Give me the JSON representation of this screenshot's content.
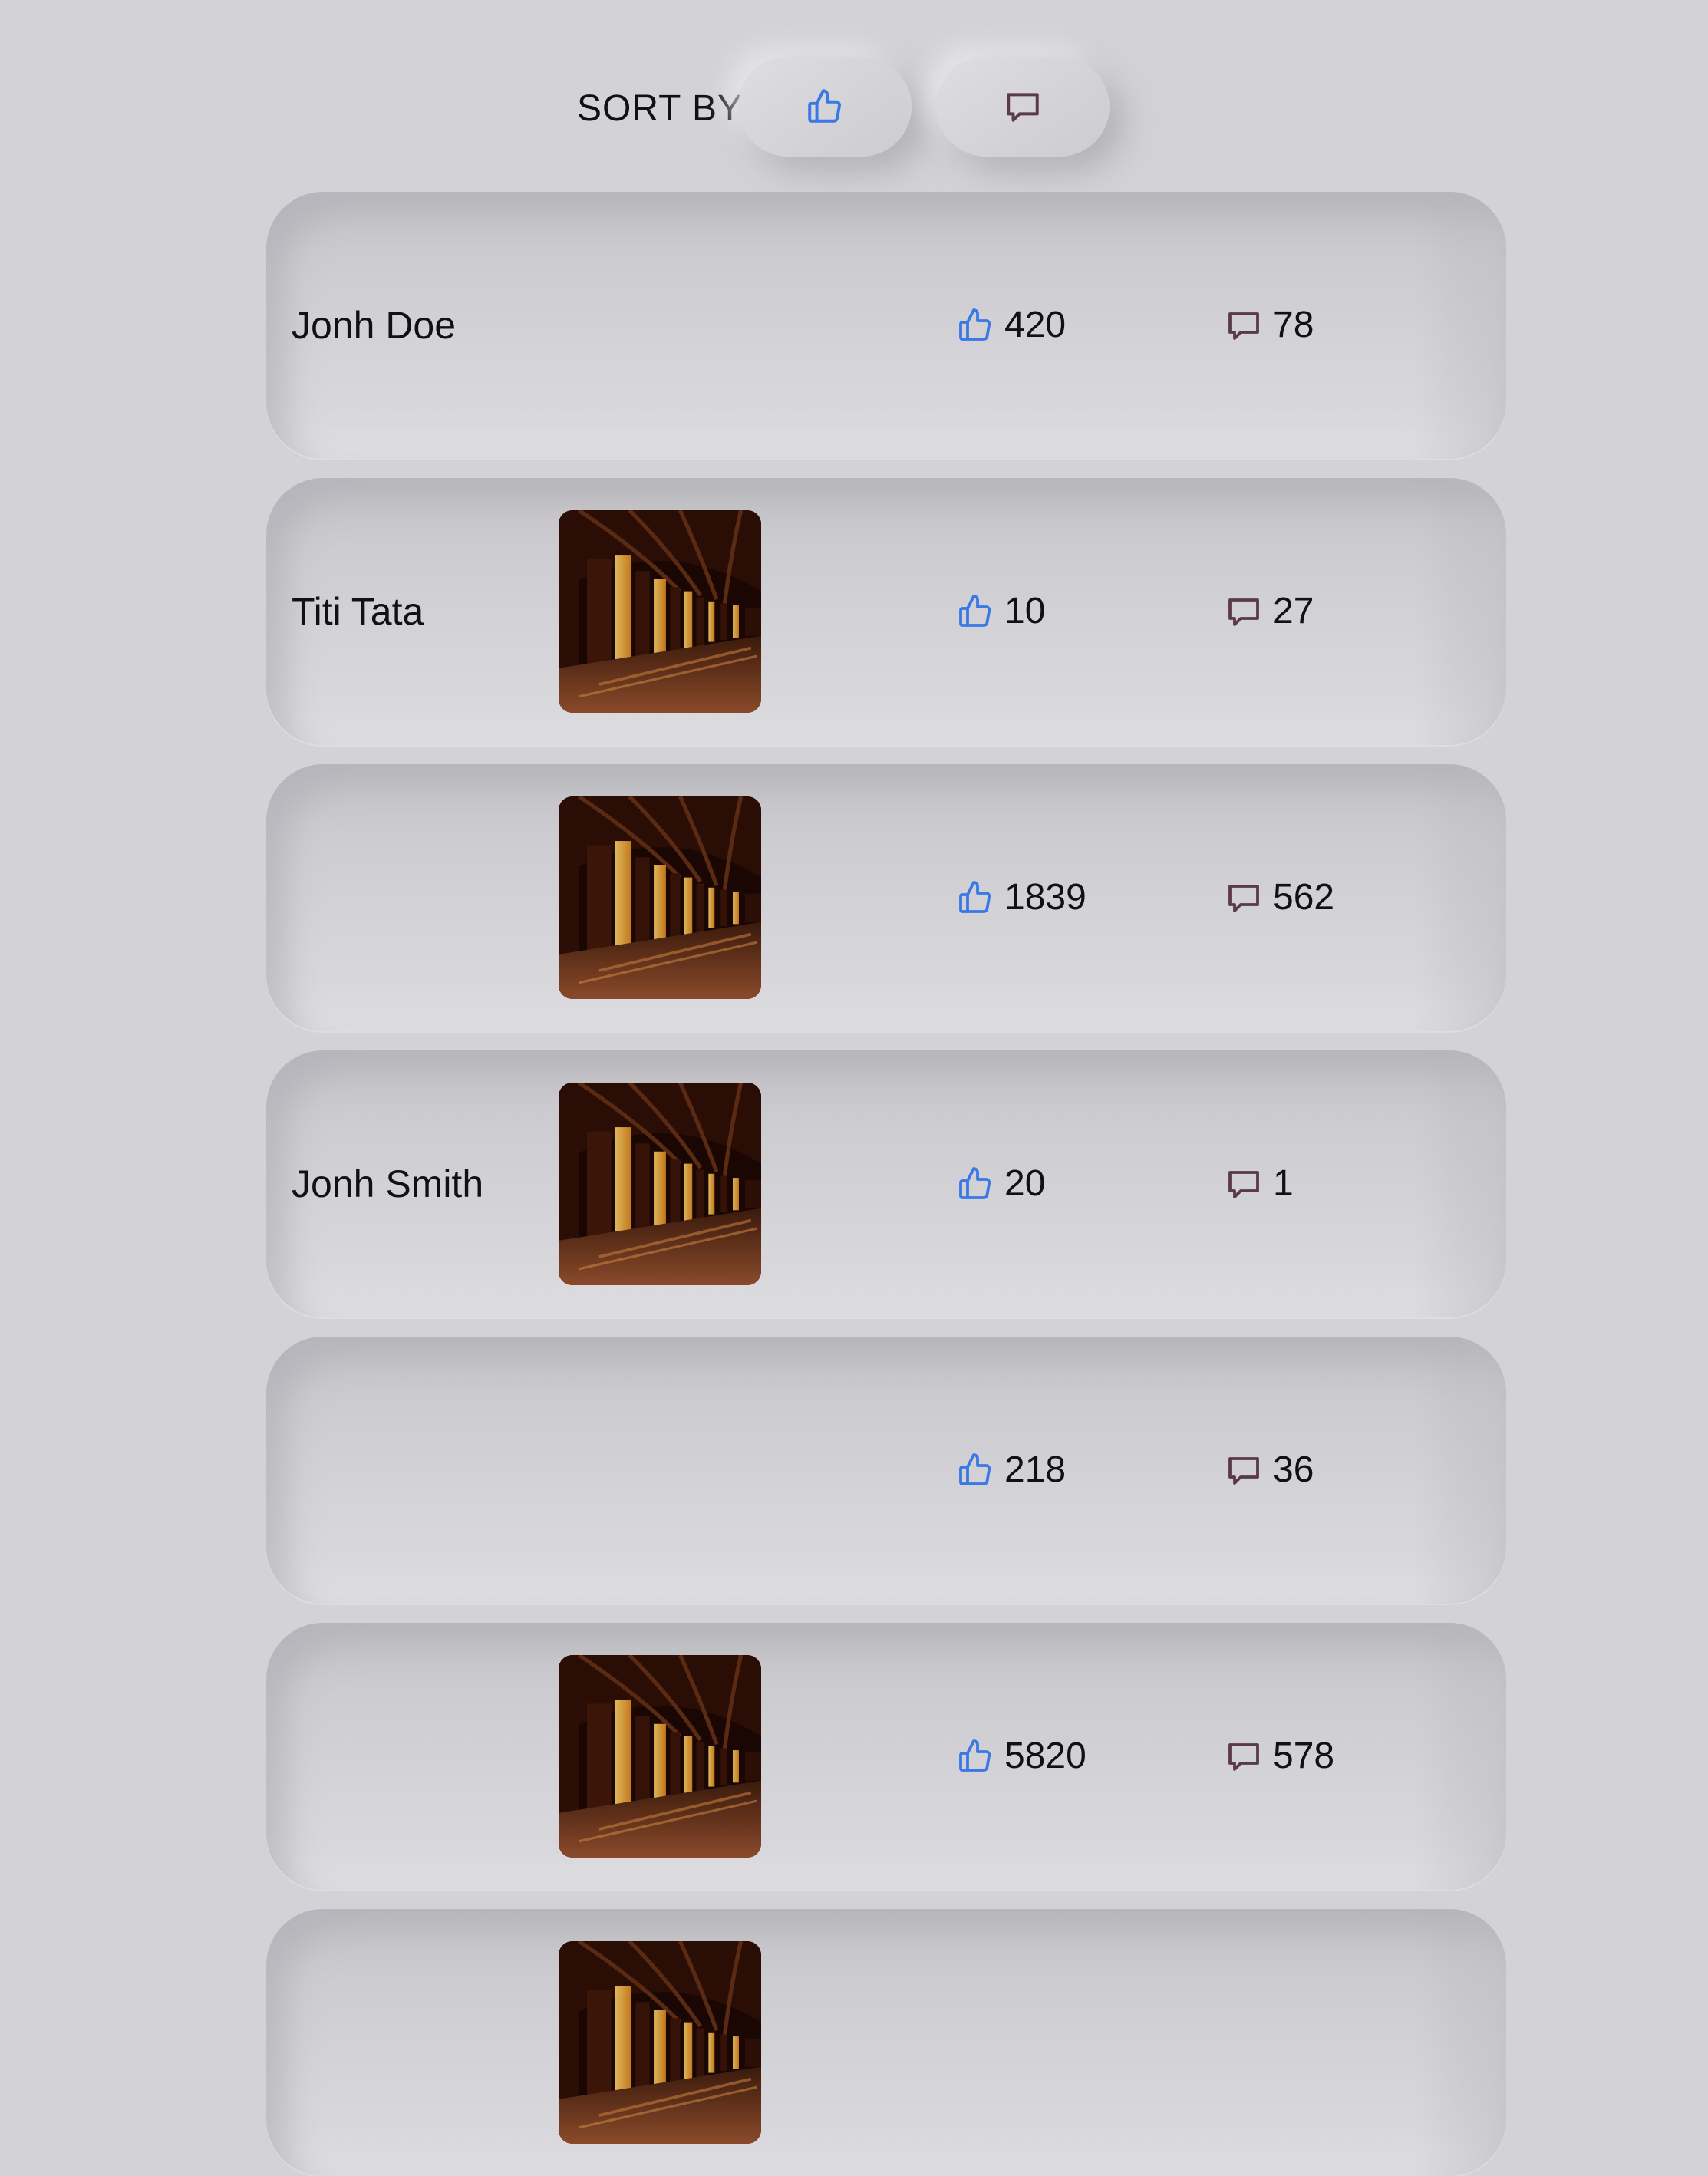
{
  "sort": {
    "label": "SORT BY:",
    "options": [
      {
        "id": "likes",
        "icon": "thumbs-up-icon",
        "color": "#3a78e6"
      },
      {
        "id": "comments",
        "icon": "comment-icon",
        "color": "#5a3a44"
      }
    ]
  },
  "posts": [
    {
      "author": "Jonh Doe",
      "has_image": false,
      "likes": "420",
      "comments": "78"
    },
    {
      "author": "Titi Tata",
      "has_image": true,
      "likes": "10",
      "comments": "27"
    },
    {
      "author": "",
      "has_image": true,
      "likes": "1839",
      "comments": "562"
    },
    {
      "author": "Jonh Smith",
      "has_image": true,
      "likes": "20",
      "comments": "1"
    },
    {
      "author": "",
      "has_image": false,
      "likes": "218",
      "comments": "36"
    },
    {
      "author": "",
      "has_image": true,
      "likes": "5820",
      "comments": "578"
    },
    {
      "author": "",
      "has_image": true,
      "likes": "",
      "comments": ""
    }
  ],
  "colors": {
    "background": "#d3d2d6",
    "like_icon": "#3a78e6",
    "comment_icon": "#5a3a44"
  }
}
